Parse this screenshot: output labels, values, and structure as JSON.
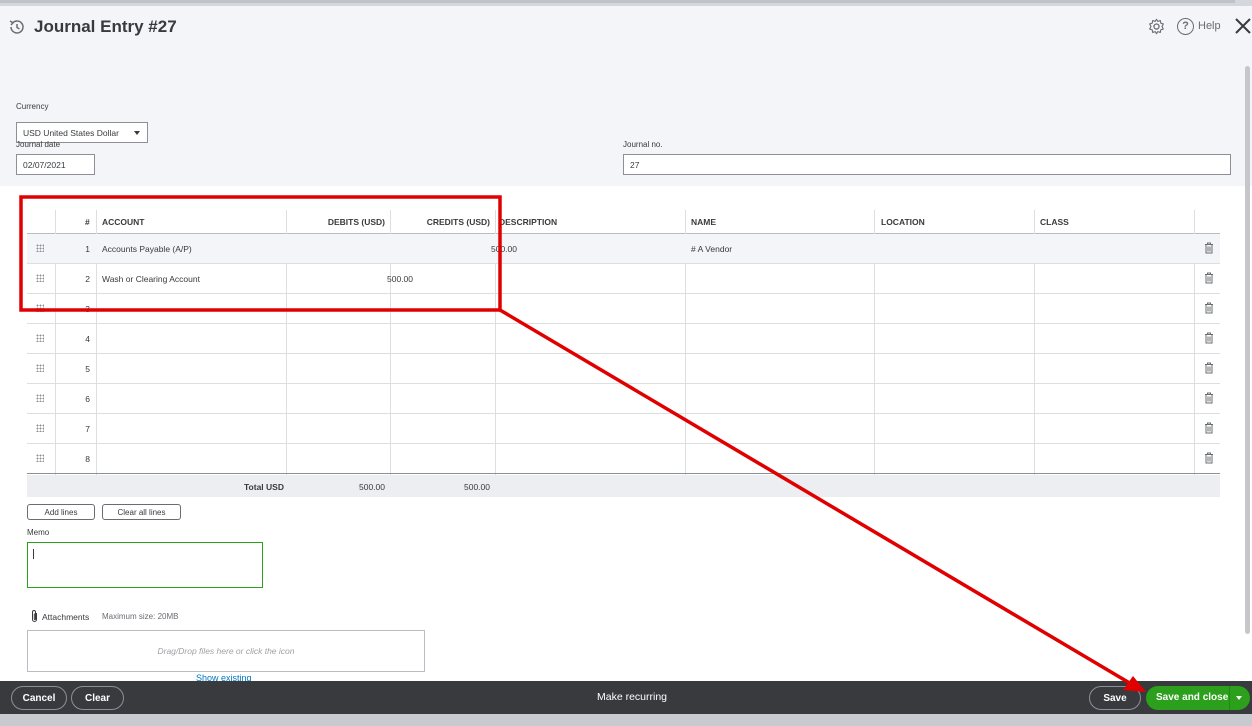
{
  "header": {
    "title": "Journal Entry #27",
    "help_label": "Help"
  },
  "form": {
    "currency_label": "Currency",
    "currency_value": "USD United States Dollar",
    "journal_date_label": "Journal date",
    "journal_date_value": "02/07/2021",
    "journal_no_label": "Journal no.",
    "journal_no_value": "27"
  },
  "table": {
    "columns": [
      "#",
      "ACCOUNT",
      "DEBITS (USD)",
      "CREDITS (USD)",
      "DESCRIPTION",
      "NAME",
      "LOCATION",
      "CLASS"
    ],
    "rows": [
      {
        "num": "1",
        "account": "Accounts Payable (A/P)",
        "debit": "",
        "credit": "500.00",
        "description": "",
        "name": "# A Vendor",
        "location": "",
        "class": ""
      },
      {
        "num": "2",
        "account": "Wash or Clearing Account",
        "debit": "500.00",
        "credit": "",
        "description": "",
        "name": "",
        "location": "",
        "class": ""
      },
      {
        "num": "3",
        "account": "",
        "debit": "",
        "credit": "",
        "description": "",
        "name": "",
        "location": "",
        "class": ""
      },
      {
        "num": "4",
        "account": "",
        "debit": "",
        "credit": "",
        "description": "",
        "name": "",
        "location": "",
        "class": ""
      },
      {
        "num": "5",
        "account": "",
        "debit": "",
        "credit": "",
        "description": "",
        "name": "",
        "location": "",
        "class": ""
      },
      {
        "num": "6",
        "account": "",
        "debit": "",
        "credit": "",
        "description": "",
        "name": "",
        "location": "",
        "class": ""
      },
      {
        "num": "7",
        "account": "",
        "debit": "",
        "credit": "",
        "description": "",
        "name": "",
        "location": "",
        "class": ""
      },
      {
        "num": "8",
        "account": "",
        "debit": "",
        "credit": "",
        "description": "",
        "name": "",
        "location": "",
        "class": ""
      }
    ],
    "total_label": "Total USD",
    "total_debits": "500.00",
    "total_credits": "500.00"
  },
  "actions": {
    "add_lines": "Add lines",
    "clear_all_lines": "Clear all lines"
  },
  "memo": {
    "label": "Memo",
    "value": ""
  },
  "attachments": {
    "label": "Attachments",
    "max_size": "Maximum size: 20MB",
    "dropzone_text": "Drag/Drop files here or click the icon",
    "show_existing": "Show existing"
  },
  "footer": {
    "cancel": "Cancel",
    "clear": "Clear",
    "make_recurring": "Make recurring",
    "save": "Save",
    "save_and_close": "Save and close"
  },
  "colors": {
    "accent_green": "#2ca01c",
    "footer_bg": "#393a3d",
    "annotation_red": "#e00000",
    "link_blue": "#0077c5"
  }
}
